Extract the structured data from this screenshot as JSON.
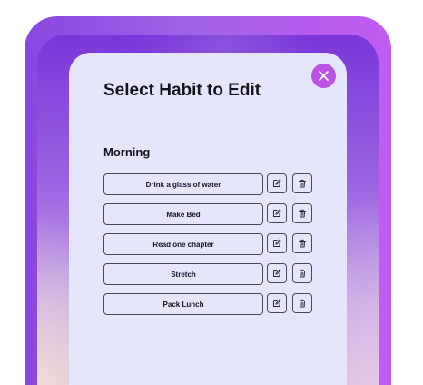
{
  "dialog": {
    "title": "Select Habit to Edit",
    "close_icon": "close-icon"
  },
  "section": {
    "title": "Morning"
  },
  "habits": [
    {
      "label": "Drink a glass of water"
    },
    {
      "label": "Make Bed"
    },
    {
      "label": "Read one chapter"
    },
    {
      "label": "Stretch"
    },
    {
      "label": "Pack Lunch"
    }
  ],
  "icons": {
    "edit": "edit-icon",
    "delete": "trash-icon"
  },
  "colors": {
    "accent": "#bb54e6",
    "dialog_background": "#e5e6fb",
    "frame_gradient_start": "#8a46e0",
    "frame_gradient_end": "#c15cf2"
  }
}
